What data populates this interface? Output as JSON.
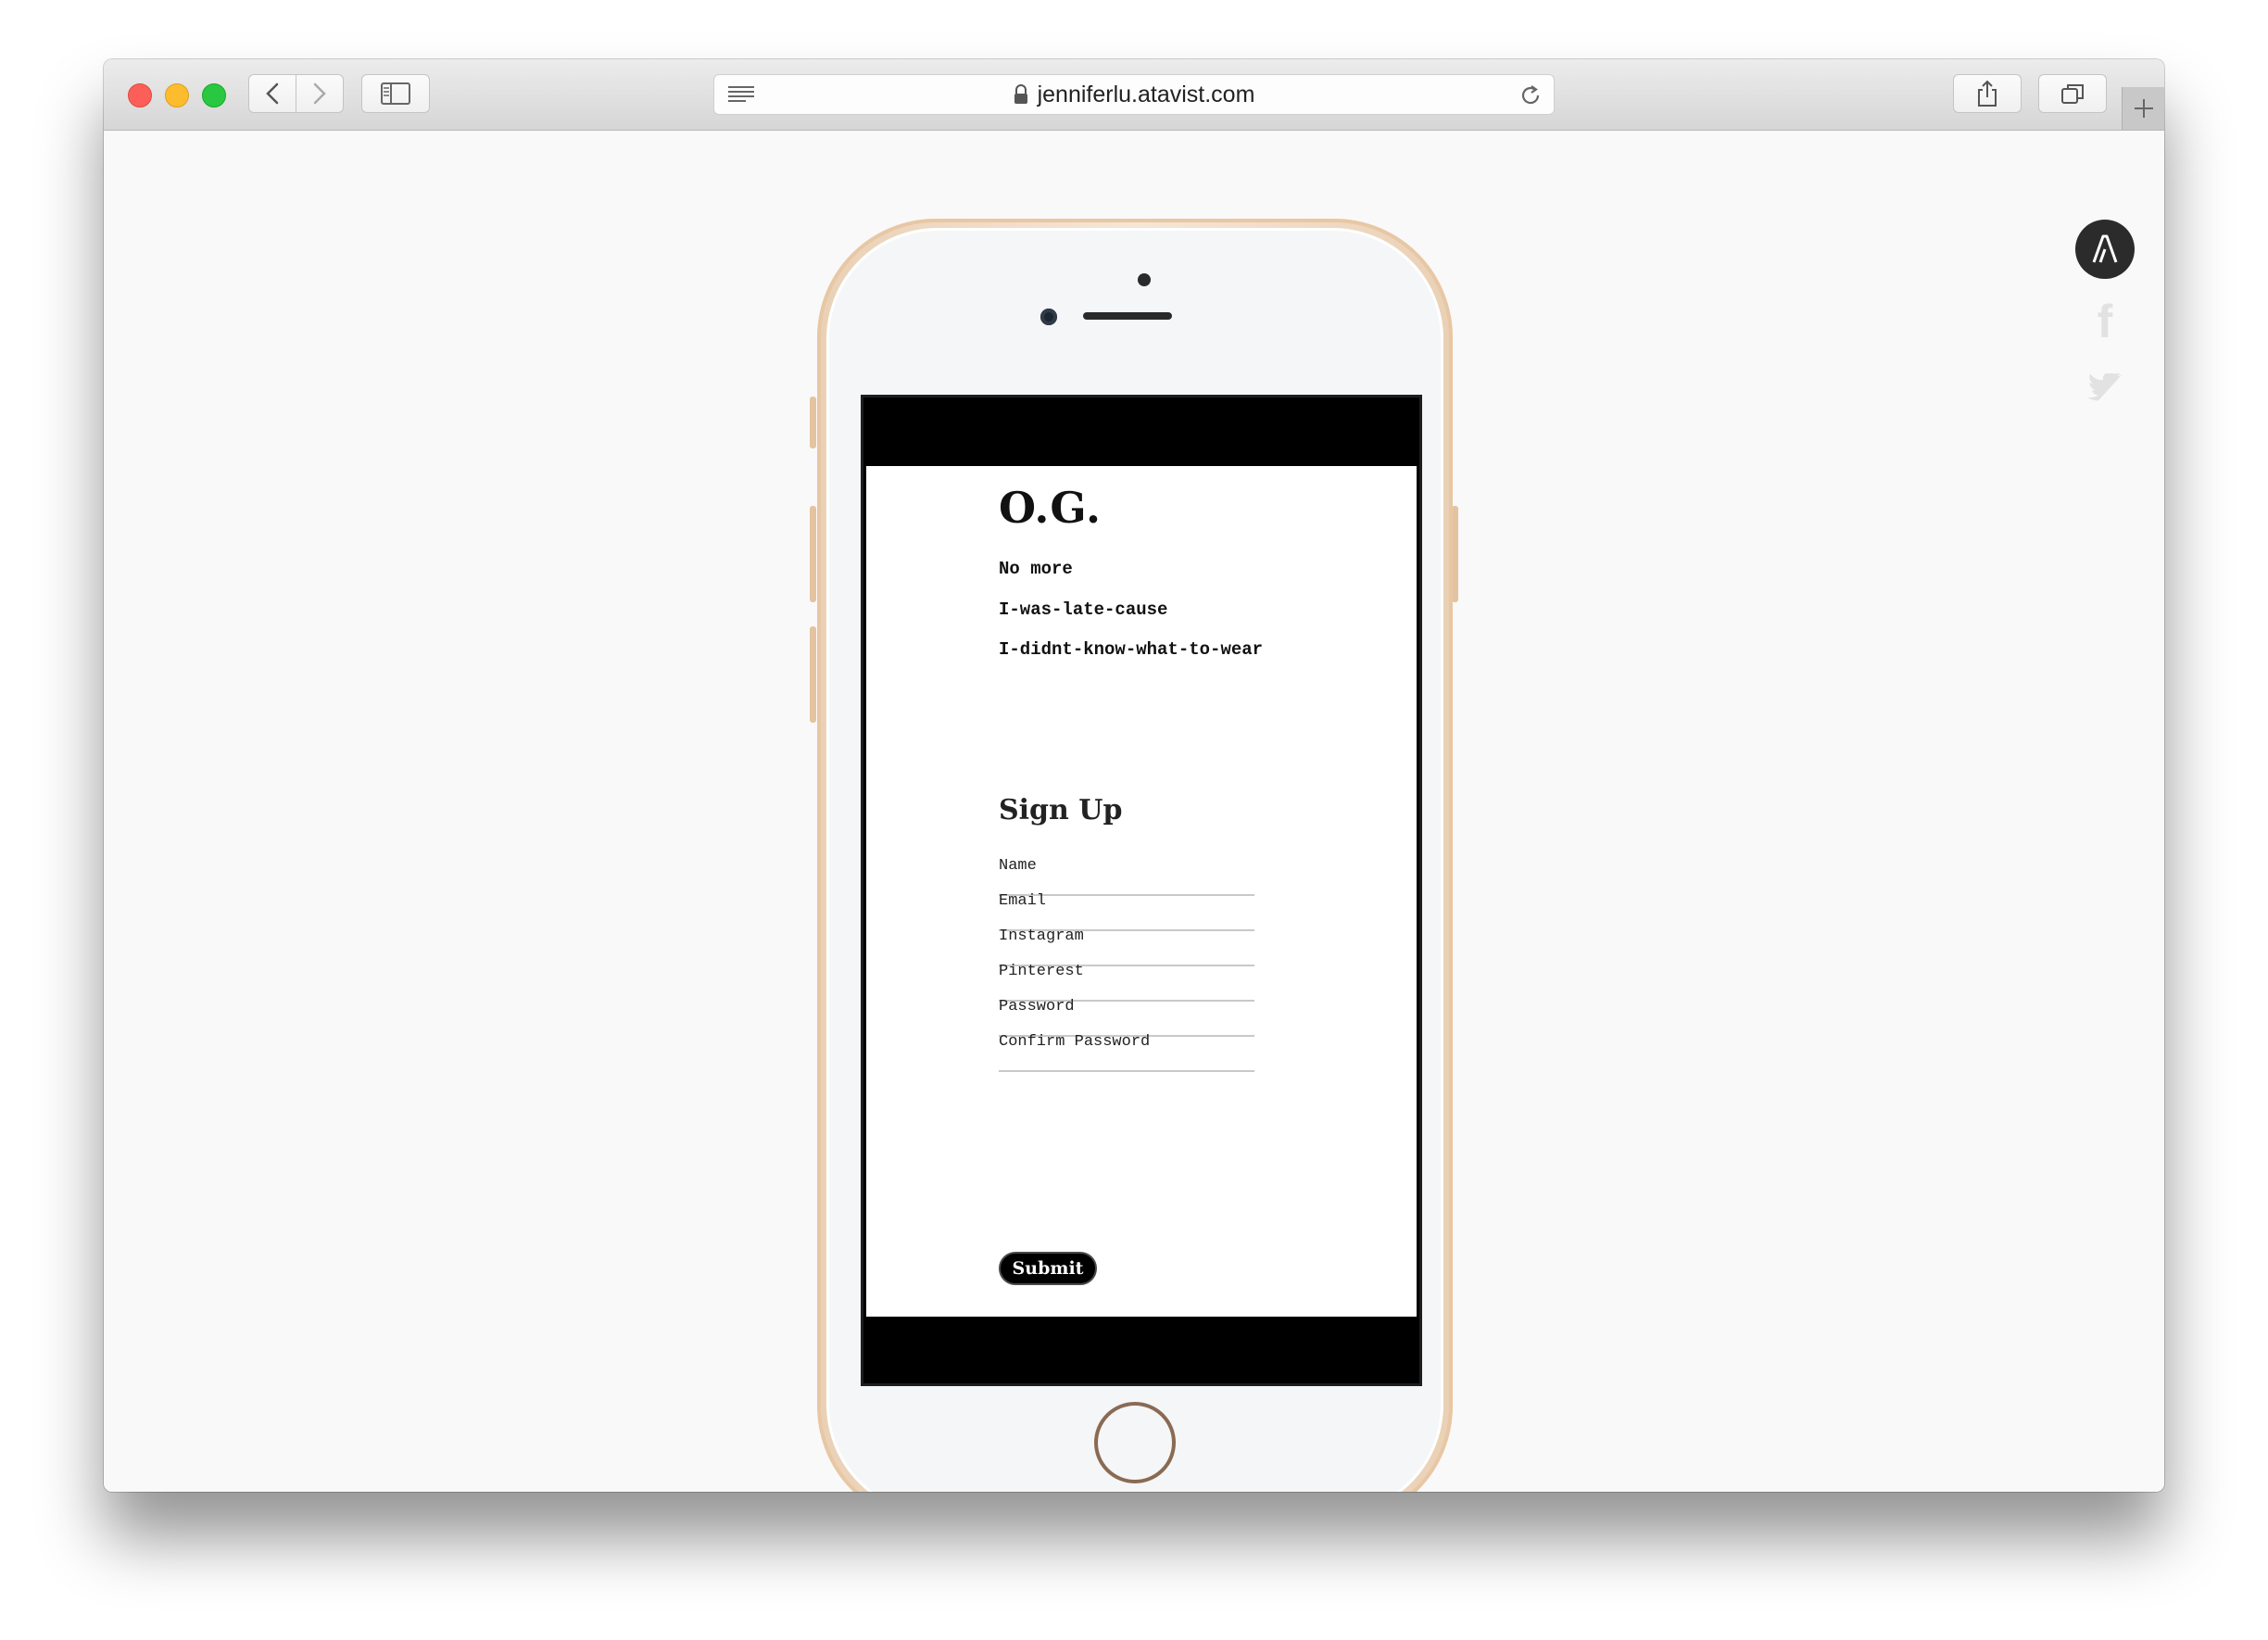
{
  "browser": {
    "url": "jenniferlu.atavist.com"
  },
  "page": {
    "title": "O.G.",
    "tagline": [
      "No more",
      "I-was-late-cause",
      "I-didnt-know-what-to-wear"
    ],
    "signup_title": "Sign Up",
    "fields": [
      "Name",
      "Email",
      "Instagram",
      "Pinterest",
      "Password",
      "Confirm Password"
    ],
    "submit_label": "Submit"
  },
  "colors": {
    "phone_frame": "#e8c7a4",
    "button_bg": "#000000",
    "logo_bg": "#2b2b2b"
  },
  "icons": {
    "brand": "atavist-logo",
    "social": [
      "facebook-icon",
      "twitter-icon"
    ]
  }
}
